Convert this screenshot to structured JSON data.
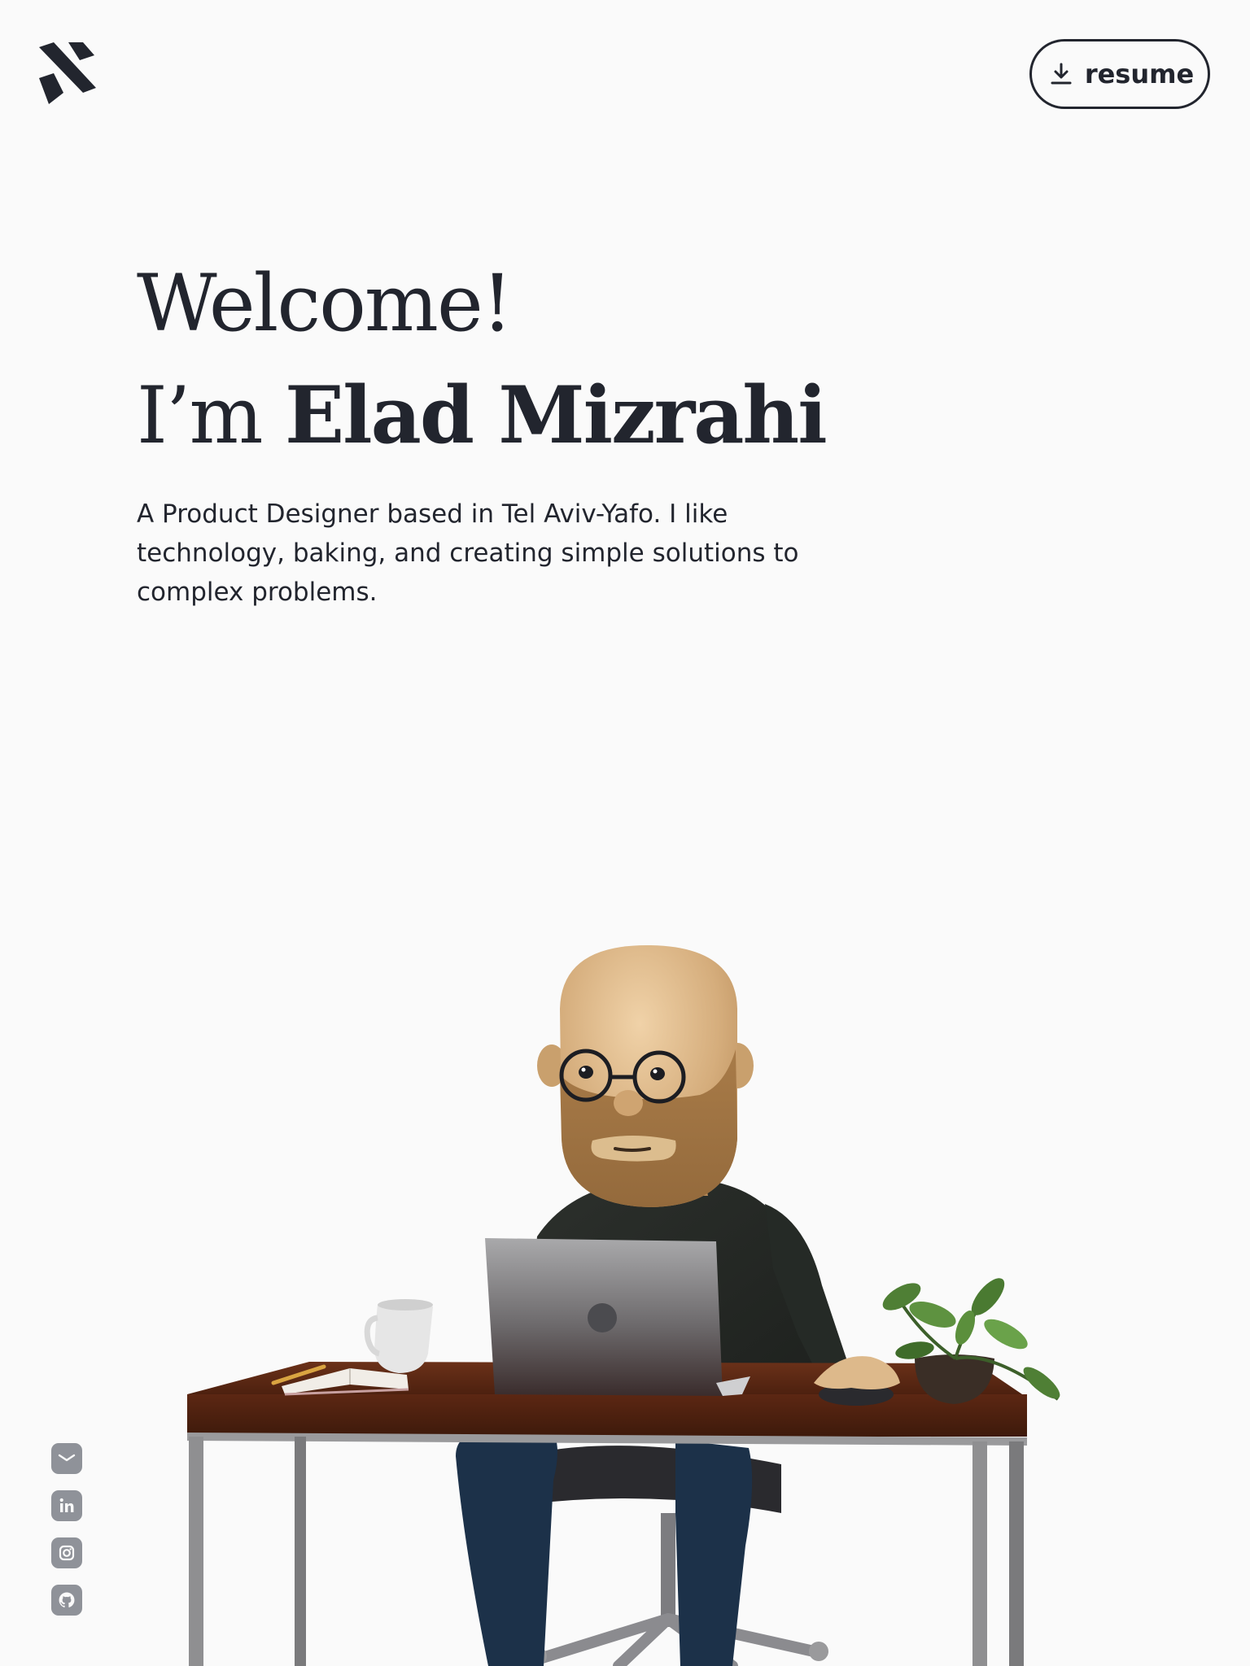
{
  "header": {
    "logo_icon": "brand-monogram-icon",
    "resume_label": "resume",
    "resume_icon": "download-icon"
  },
  "hero": {
    "welcome": "Welcome!",
    "intro_prefix": "I’m ",
    "name": "Elad Mizrahi",
    "tagline": "A Product Designer based in Tel Aviv-Yafo. I like technology, baking, and creating simple solutions to complex problems."
  },
  "social": [
    {
      "icon": "mail-icon"
    },
    {
      "icon": "linkedin-icon"
    },
    {
      "icon": "instagram-icon"
    },
    {
      "icon": "github-icon"
    }
  ],
  "colors": {
    "background": "#fafafa",
    "text": "#22252e",
    "social_icon": "#8f9299",
    "desk_wood": "#5a2614",
    "desk_legs": "#8c8c8c"
  },
  "illustration": {
    "subject": "avatar-at-desk-illustration"
  }
}
